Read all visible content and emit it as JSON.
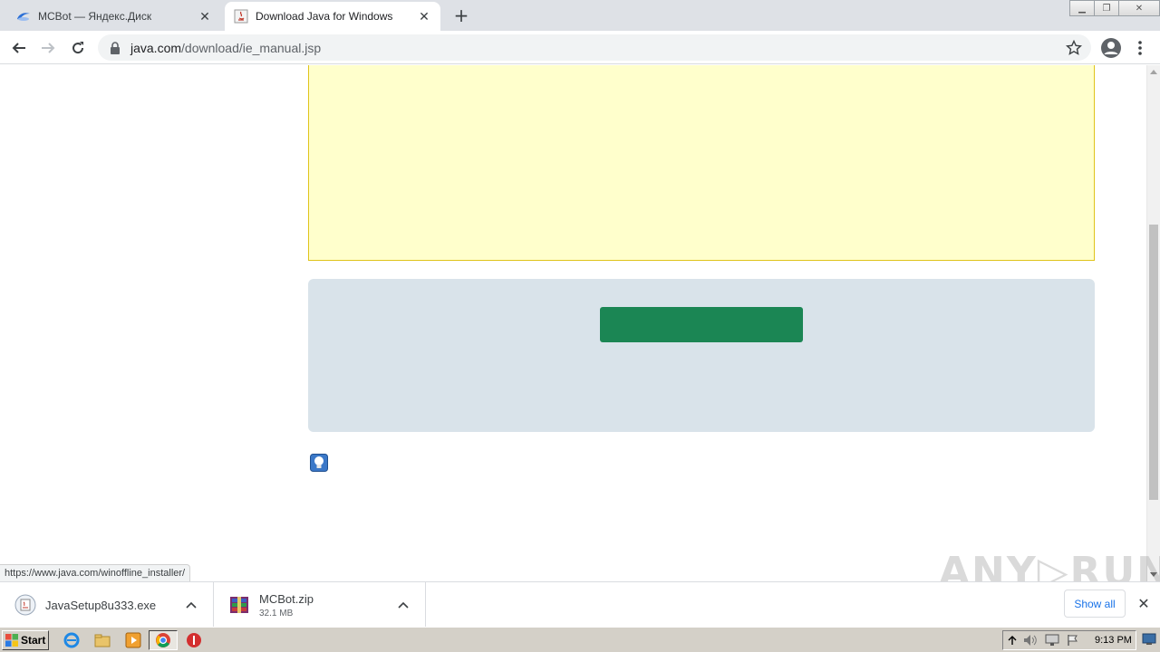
{
  "browser": {
    "tabs": [
      {
        "title": "MCBot — Яндекс.Диск",
        "active": false
      },
      {
        "title": "Download Java for Windows",
        "active": true
      }
    ],
    "address": {
      "host": "java.com",
      "path": "/download/ie_manual.jsp"
    },
    "status_url": "https://www.java.com/winoffline_installer/"
  },
  "downloads": {
    "items": [
      {
        "name": "JavaSetup8u333.exe",
        "size": ""
      },
      {
        "name": "MCBot.zip",
        "size": "32.1 MB"
      }
    ],
    "show_all_label": "Show all"
  },
  "watermark": "ANY▷RUN",
  "taskbar": {
    "start_label": "Start",
    "clock": "9:13 PM"
  },
  "colors": {
    "yellow_box": "#ffffcc",
    "gray_box": "#d9e3ea",
    "download_button": "#1b8654"
  }
}
